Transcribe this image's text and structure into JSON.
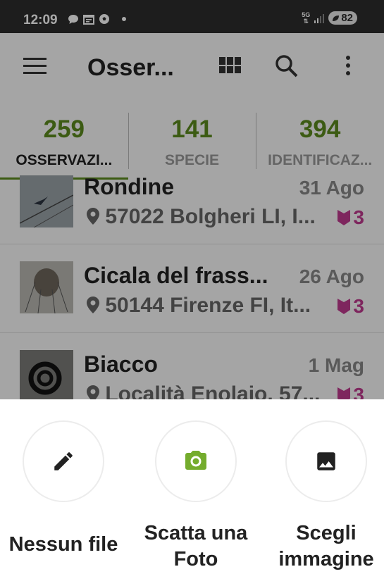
{
  "status_bar": {
    "time": "12:09",
    "network": "5G",
    "battery": "82"
  },
  "toolbar": {
    "title": "Osser..."
  },
  "tabs": [
    {
      "count": "259",
      "label": "OSSERVAZI..."
    },
    {
      "count": "141",
      "label": "SPECIE"
    },
    {
      "count": "394",
      "label": "IDENTIFICAZ..."
    }
  ],
  "observations": [
    {
      "title": "Rondine",
      "date": "31 Ago",
      "place": "57022 Bolgheri LI, I...",
      "ids": "3"
    },
    {
      "title": "Cicala del frass...",
      "date": "26 Ago",
      "place": "50144 Firenze FI, It...",
      "ids": "3"
    },
    {
      "title": "Biacco",
      "date": "1 Mag",
      "place": "Località Enolaio, 57...",
      "ids": "3"
    }
  ],
  "sheet": {
    "no_file": "Nessun file",
    "take_photo_line1": "Scatta una",
    "take_photo_line2": "Foto",
    "choose_image_line1": "Scegli",
    "choose_image_line2": "immagine"
  },
  "colors": {
    "accent_green": "#5b8a1e",
    "id_magenta": "#c03b8f"
  },
  "icons": [
    "pencil-icon",
    "camera-icon",
    "image-icon",
    "menu-icon",
    "grid-icon",
    "search-icon",
    "more-vert-icon",
    "location-pin-icon",
    "identification-leaf-icon"
  ]
}
